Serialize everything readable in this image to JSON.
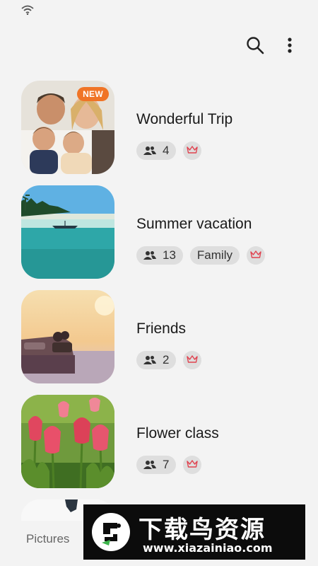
{
  "status_bar": {
    "wifi_icon": "wifi-icon"
  },
  "action_bar": {
    "search_icon": "search-icon",
    "more_icon": "more-vertical-icon"
  },
  "albums": [
    {
      "title": "Wonderful Trip",
      "badge": "NEW",
      "members": "4",
      "tag": "",
      "crown_icon": "crown-icon"
    },
    {
      "title": "Summer vacation",
      "badge": "",
      "members": "13",
      "tag": "Family",
      "crown_icon": "crown-icon"
    },
    {
      "title": "Friends",
      "badge": "",
      "members": "2",
      "tag": "",
      "crown_icon": "crown-icon"
    },
    {
      "title": "Flower class",
      "badge": "",
      "members": "7",
      "tag": "",
      "crown_icon": "crown-icon"
    }
  ],
  "bottom_nav": {
    "tab_pictures": "Pictures"
  },
  "watermark": {
    "title": "下载鸟资源",
    "url": "www.xiazainiao.com"
  },
  "colors": {
    "badge": "#f07426",
    "crown": "#e0424f",
    "chip": "#dedede",
    "background": "#f3f3f3"
  }
}
